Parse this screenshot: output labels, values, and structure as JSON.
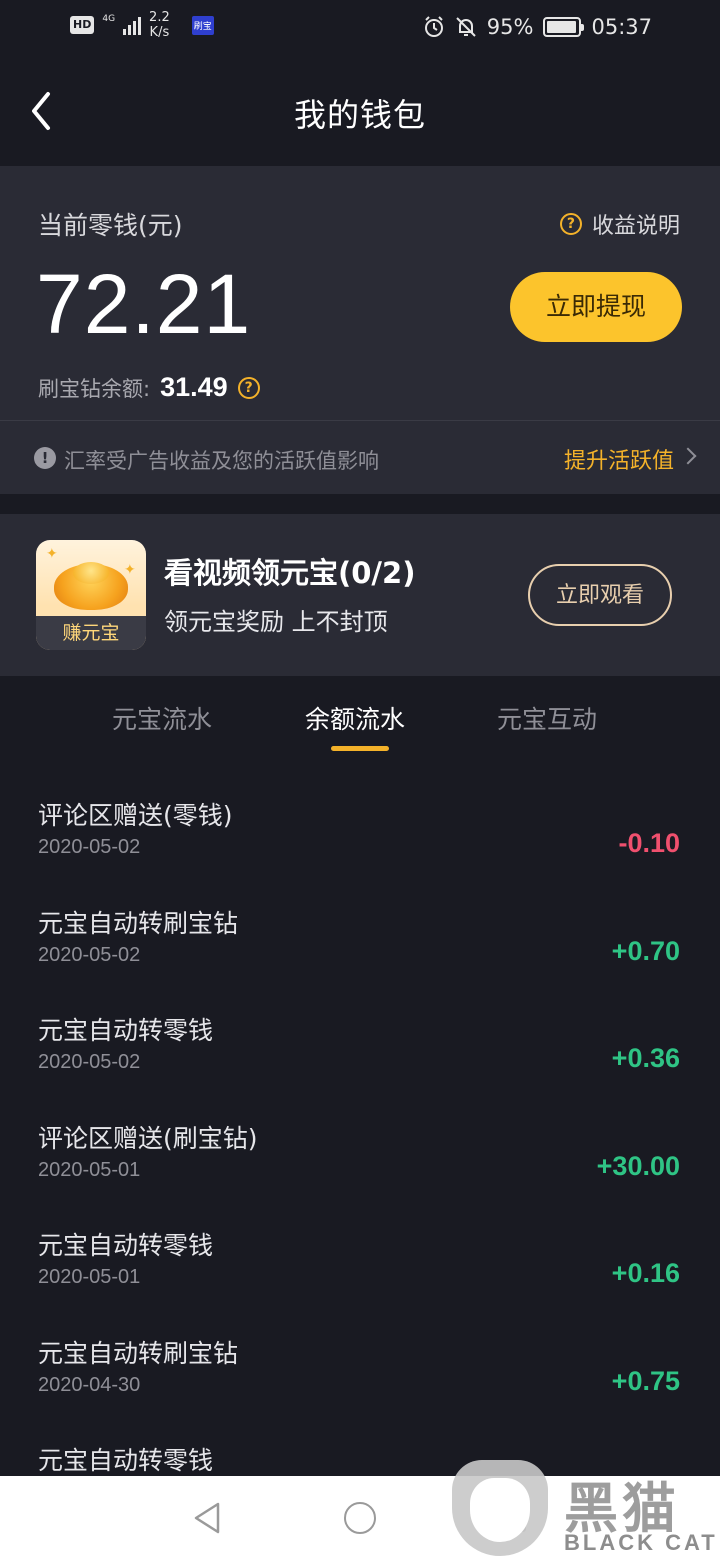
{
  "status_bar": {
    "hd": "HD",
    "network": "4G",
    "speed_top": "2.2",
    "speed_bottom": "K/s",
    "app_tag": "刷宝",
    "battery": "95%",
    "time": "05:37",
    "battery_level": 0.95
  },
  "nav": {
    "title": "我的钱包"
  },
  "wallet": {
    "label": "当前零钱(元)",
    "explain": "收益说明",
    "amount": "72.21",
    "withdraw": "立即提现",
    "diamond_label": "刷宝钻余额:",
    "diamond_value": "31.49"
  },
  "notice": {
    "text": "汇率受广告收益及您的活跃值影响",
    "link": "提升活跃值"
  },
  "promo": {
    "icon_label": "赚元宝",
    "title": "看视频领元宝(0/2)",
    "subtitle": "领元宝奖励 上不封顶",
    "button": "立即观看"
  },
  "tabs": [
    {
      "label": "元宝流水",
      "active": false
    },
    {
      "label": "余额流水",
      "active": true
    },
    {
      "label": "元宝互动",
      "active": false
    }
  ],
  "transactions": [
    {
      "title": "评论区赠送(零钱)",
      "date": "2020-05-02",
      "amount": "-0.10",
      "type": "debit"
    },
    {
      "title": "元宝自动转刷宝钻",
      "date": "2020-05-02",
      "amount": "+0.70",
      "type": "credit"
    },
    {
      "title": "元宝自动转零钱",
      "date": "2020-05-02",
      "amount": "+0.36",
      "type": "credit"
    },
    {
      "title": "评论区赠送(刷宝钻)",
      "date": "2020-05-01",
      "amount": "+30.00",
      "type": "credit"
    },
    {
      "title": "元宝自动转零钱",
      "date": "2020-05-01",
      "amount": "+0.16",
      "type": "credit"
    },
    {
      "title": "元宝自动转刷宝钻",
      "date": "2020-04-30",
      "amount": "+0.75",
      "type": "credit"
    },
    {
      "title": "元宝自动转零钱",
      "date": "",
      "amount": "",
      "type": "credit"
    }
  ],
  "colors": {
    "debit": "#f0506e",
    "credit": "#2fc485",
    "accent": "#f4b22a"
  },
  "watermark": {
    "big": "黑猫",
    "small": "BLACK CAT"
  }
}
